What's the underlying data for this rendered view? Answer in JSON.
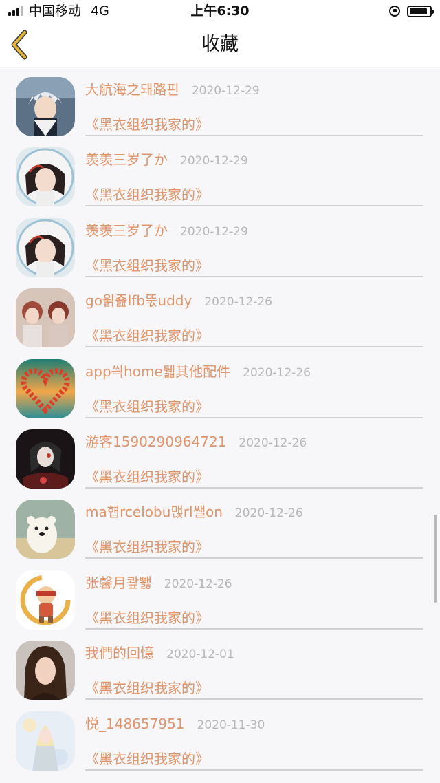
{
  "status_bar": {
    "carrier": "中国移动",
    "network": "4G",
    "time": "上午6:30",
    "signal_bars_active": 3,
    "battery_level": 0.9
  },
  "nav": {
    "title": "收藏",
    "back_icon": "chevron-left-icon",
    "accent_color": "#e4b53a"
  },
  "colors": {
    "name_text": "#e0956a",
    "date_text": "#b8b8b8",
    "divider": "#cfcfd4",
    "background": "#f7f6f8"
  },
  "favorites": [
    {
      "name": "大航海之돼路핀",
      "date": "2020-12-29",
      "work": "《黑衣组织我家的》",
      "avatar": "anime-silver-hair-avatar"
    },
    {
      "name": "羡羡三岁了か",
      "date": "2020-12-29",
      "work": "《黑衣组织我家的》",
      "avatar": "anime-girl-avatar"
    },
    {
      "name": "羡羡三岁了か",
      "date": "2020-12-29",
      "work": "《黑衣组织我家的》",
      "avatar": "anime-girl-avatar"
    },
    {
      "name": "go윍죮lfb뚟uddy",
      "date": "2020-12-26",
      "work": "《黑衣组织我家的》",
      "avatar": "two-girls-photo-avatar"
    },
    {
      "name": "app씍home뒓其他配件",
      "date": "2020-12-26",
      "work": "《黑衣组织我家的》",
      "avatar": "flower-heart-avatar"
    },
    {
      "name": "游客1590290964721",
      "date": "2020-12-26",
      "work": "《黑衣组织我家的》",
      "avatar": "dark-anime-avatar"
    },
    {
      "name": "ma햽rcelobu맩rl쌜on",
      "date": "2020-12-26",
      "work": "《黑衣组织我家的》",
      "avatar": "polar-bear-avatar"
    },
    {
      "name": "张馨月쾊뾇",
      "date": "2020-12-26",
      "work": "《黑衣组织我家的》",
      "avatar": "cartoon-ninja-avatar"
    },
    {
      "name": "我們的回憶",
      "date": "2020-12-01",
      "work": "《黑衣组织我家的》",
      "avatar": "woman-portrait-avatar"
    },
    {
      "name": "悦_148657951",
      "date": "2020-11-30",
      "work": "《黑衣组织我家的》",
      "avatar": "light-anime-avatar"
    }
  ]
}
